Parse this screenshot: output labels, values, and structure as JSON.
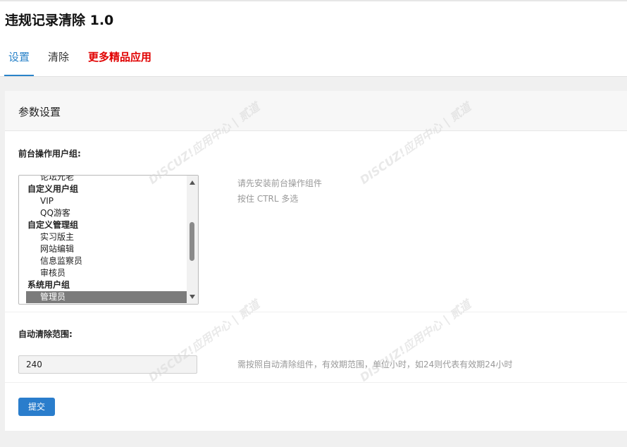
{
  "app": {
    "title": "违规记录清除 1.0"
  },
  "tabs": [
    {
      "label": "设置",
      "active": true
    },
    {
      "label": "清除",
      "active": false
    },
    {
      "label": "更多精品应用",
      "active": false
    }
  ],
  "card": {
    "title": "参数设置"
  },
  "groups_field": {
    "label": "前台操作用户组:",
    "items": [
      {
        "label": "论坛元老",
        "type": "option",
        "selected": false
      },
      {
        "label": "自定义用户组",
        "type": "group",
        "selected": false
      },
      {
        "label": "VIP",
        "type": "option",
        "selected": false
      },
      {
        "label": "QQ游客",
        "type": "option",
        "selected": false
      },
      {
        "label": "自定义管理组",
        "type": "group",
        "selected": false
      },
      {
        "label": "实习版主",
        "type": "option",
        "selected": false
      },
      {
        "label": "网站编辑",
        "type": "option",
        "selected": false
      },
      {
        "label": "信息监察员",
        "type": "option",
        "selected": false
      },
      {
        "label": "审核员",
        "type": "option",
        "selected": false
      },
      {
        "label": "系统用户组",
        "type": "group",
        "selected": false
      },
      {
        "label": "管理员",
        "type": "option",
        "selected": true
      }
    ],
    "hint_1": "请先安装前台操作组件",
    "hint_2": "按住 CTRL 多选"
  },
  "range_field": {
    "label": "自动清除范围:",
    "value": "240",
    "hint": "需按照自动清除组件，有效期范围，单位小时，如24则代表有效期24小时"
  },
  "submit": {
    "label": "提交"
  },
  "watermark": {
    "text": "DISCUZ!应用中心 | 贰道"
  },
  "colors": {
    "accent": "#2a83c9",
    "highlight_red": "#e10000",
    "button": "#2a7dcc"
  },
  "icons": {
    "scroll_up": "triangle-up",
    "scroll_down": "triangle-down"
  }
}
